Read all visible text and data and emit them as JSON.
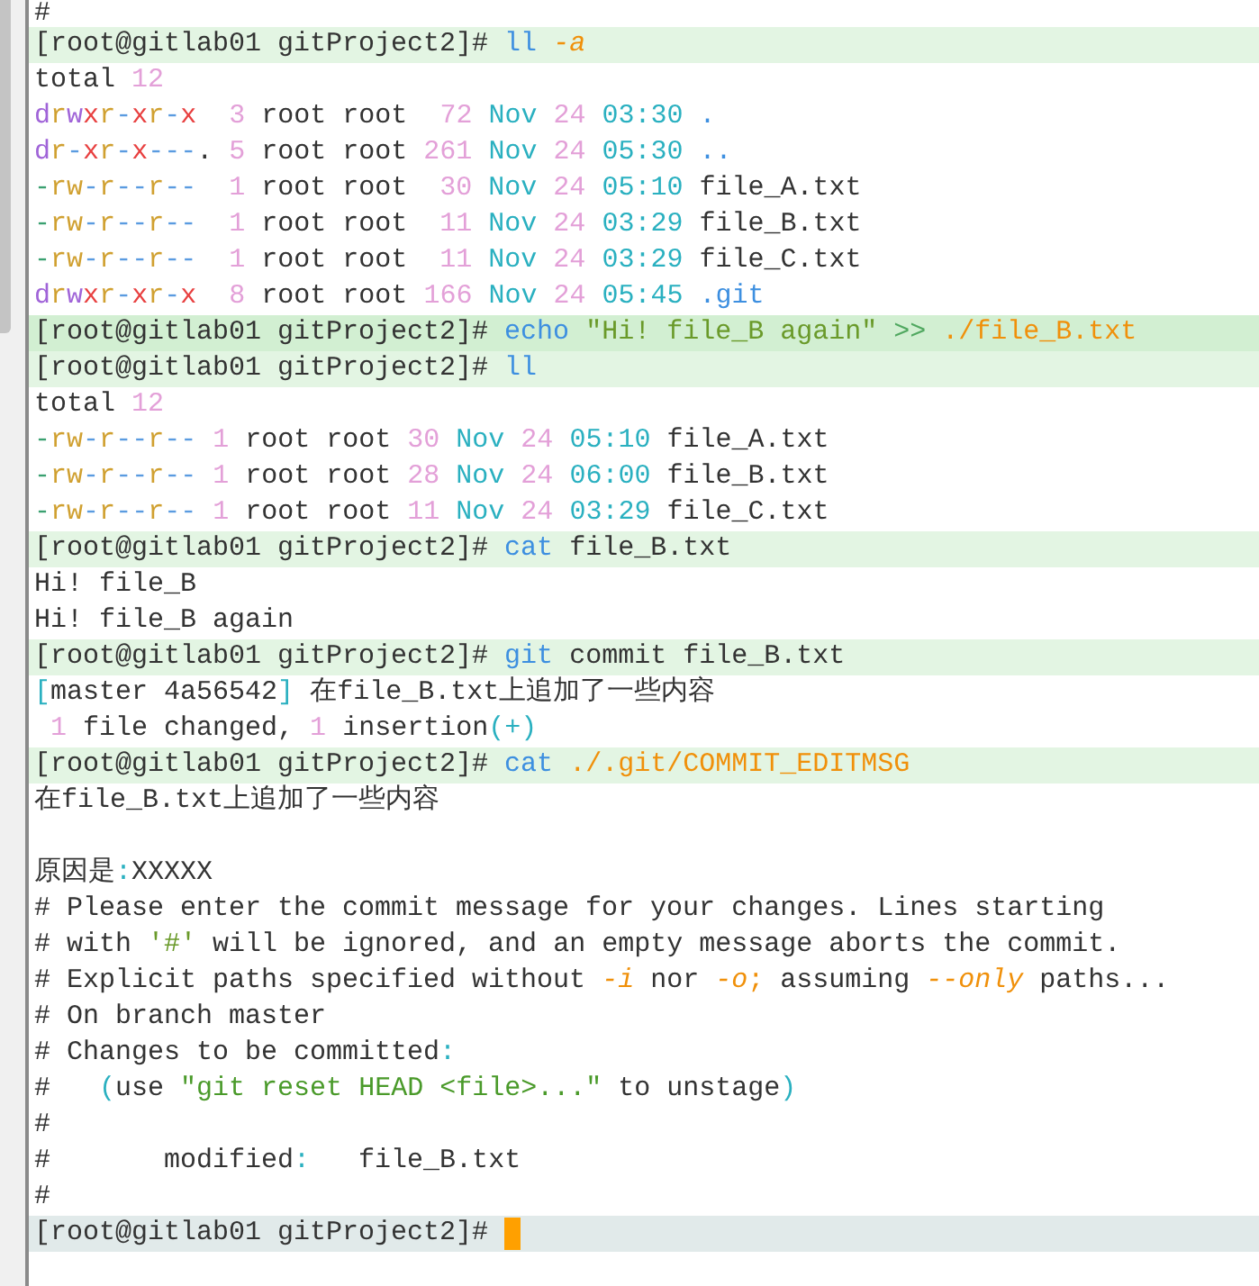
{
  "terminal": {
    "lines": [
      {
        "kind": "output",
        "segments": [
          {
            "text": "#",
            "color": "#333333"
          }
        ]
      },
      {
        "kind": "command",
        "segments": [
          {
            "text": "[root@gitlab01 gitProject2]# ",
            "color": "#333333"
          },
          {
            "text": "ll ",
            "color": "#3d8fe0"
          },
          {
            "text": "-a",
            "color": "#f0900a",
            "italic": true
          }
        ]
      },
      {
        "kind": "output",
        "segments": [
          {
            "text": "total ",
            "color": "#333333"
          },
          {
            "text": "12",
            "color": "#e3a0d8"
          }
        ]
      },
      {
        "kind": "output",
        "segments": [
          {
            "text": "d",
            "color": "#a064d8"
          },
          {
            "text": "r",
            "color": "#d0a030"
          },
          {
            "text": "w",
            "color": "#a064d8"
          },
          {
            "text": "x",
            "color": "#e84040"
          },
          {
            "text": "r",
            "color": "#d0a030"
          },
          {
            "text": "-",
            "color": "#5a9be0"
          },
          {
            "text": "x",
            "color": "#e84040"
          },
          {
            "text": "r",
            "color": "#d0a030"
          },
          {
            "text": "-",
            "color": "#5a9be0"
          },
          {
            "text": "x",
            "color": "#e84040"
          },
          {
            "text": "  3 ",
            "color": "#e3a0d8"
          },
          {
            "text": "root root ",
            "color": "#333333"
          },
          {
            "text": " 72 ",
            "color": "#e3a0d8"
          },
          {
            "text": "Nov ",
            "color": "#2ab0c0"
          },
          {
            "text": "24 ",
            "color": "#e3a0d8"
          },
          {
            "text": "03:30 ",
            "color": "#2ab0c0"
          },
          {
            "text": ".",
            "color": "#3d8fe0"
          }
        ]
      },
      {
        "kind": "output",
        "segments": [
          {
            "text": "d",
            "color": "#a064d8"
          },
          {
            "text": "r",
            "color": "#d0a030"
          },
          {
            "text": "-",
            "color": "#5a9be0"
          },
          {
            "text": "x",
            "color": "#e84040"
          },
          {
            "text": "r",
            "color": "#d0a030"
          },
          {
            "text": "-",
            "color": "#5a9be0"
          },
          {
            "text": "x",
            "color": "#e84040"
          },
          {
            "text": "---",
            "color": "#5a9be0"
          },
          {
            "text": ". ",
            "color": "#333333"
          },
          {
            "text": "5 ",
            "color": "#e3a0d8"
          },
          {
            "text": "root root ",
            "color": "#333333"
          },
          {
            "text": "261 ",
            "color": "#e3a0d8"
          },
          {
            "text": "Nov ",
            "color": "#2ab0c0"
          },
          {
            "text": "24 ",
            "color": "#e3a0d8"
          },
          {
            "text": "05:30 ",
            "color": "#2ab0c0"
          },
          {
            "text": "..",
            "color": "#3d8fe0"
          }
        ]
      },
      {
        "kind": "output",
        "segments": [
          {
            "text": "-",
            "color": "#3aa070"
          },
          {
            "text": "rw",
            "color": "#d0a030"
          },
          {
            "text": "-",
            "color": "#5a9be0"
          },
          {
            "text": "r",
            "color": "#d0a030"
          },
          {
            "text": "--",
            "color": "#5a9be0"
          },
          {
            "text": "r",
            "color": "#d0a030"
          },
          {
            "text": "--",
            "color": "#5a9be0"
          },
          {
            "text": "  1 ",
            "color": "#e3a0d8"
          },
          {
            "text": "root root ",
            "color": "#333333"
          },
          {
            "text": " 30 ",
            "color": "#e3a0d8"
          },
          {
            "text": "Nov ",
            "color": "#2ab0c0"
          },
          {
            "text": "24 ",
            "color": "#e3a0d8"
          },
          {
            "text": "05:10 ",
            "color": "#2ab0c0"
          },
          {
            "text": "file_A.txt",
            "color": "#333333"
          }
        ]
      },
      {
        "kind": "output",
        "segments": [
          {
            "text": "-",
            "color": "#3aa070"
          },
          {
            "text": "rw",
            "color": "#d0a030"
          },
          {
            "text": "-",
            "color": "#5a9be0"
          },
          {
            "text": "r",
            "color": "#d0a030"
          },
          {
            "text": "--",
            "color": "#5a9be0"
          },
          {
            "text": "r",
            "color": "#d0a030"
          },
          {
            "text": "--",
            "color": "#5a9be0"
          },
          {
            "text": "  1 ",
            "color": "#e3a0d8"
          },
          {
            "text": "root root ",
            "color": "#333333"
          },
          {
            "text": " 11 ",
            "color": "#e3a0d8"
          },
          {
            "text": "Nov ",
            "color": "#2ab0c0"
          },
          {
            "text": "24 ",
            "color": "#e3a0d8"
          },
          {
            "text": "03:29 ",
            "color": "#2ab0c0"
          },
          {
            "text": "file_B.txt",
            "color": "#333333"
          }
        ]
      },
      {
        "kind": "output",
        "segments": [
          {
            "text": "-",
            "color": "#3aa070"
          },
          {
            "text": "rw",
            "color": "#d0a030"
          },
          {
            "text": "-",
            "color": "#5a9be0"
          },
          {
            "text": "r",
            "color": "#d0a030"
          },
          {
            "text": "--",
            "color": "#5a9be0"
          },
          {
            "text": "r",
            "color": "#d0a030"
          },
          {
            "text": "--",
            "color": "#5a9be0"
          },
          {
            "text": "  1 ",
            "color": "#e3a0d8"
          },
          {
            "text": "root root ",
            "color": "#333333"
          },
          {
            "text": " 11 ",
            "color": "#e3a0d8"
          },
          {
            "text": "Nov ",
            "color": "#2ab0c0"
          },
          {
            "text": "24 ",
            "color": "#e3a0d8"
          },
          {
            "text": "03:29 ",
            "color": "#2ab0c0"
          },
          {
            "text": "file_C.txt",
            "color": "#333333"
          }
        ]
      },
      {
        "kind": "output",
        "segments": [
          {
            "text": "d",
            "color": "#a064d8"
          },
          {
            "text": "r",
            "color": "#d0a030"
          },
          {
            "text": "w",
            "color": "#a064d8"
          },
          {
            "text": "x",
            "color": "#e84040"
          },
          {
            "text": "r",
            "color": "#d0a030"
          },
          {
            "text": "-",
            "color": "#5a9be0"
          },
          {
            "text": "x",
            "color": "#e84040"
          },
          {
            "text": "r",
            "color": "#d0a030"
          },
          {
            "text": "-",
            "color": "#5a9be0"
          },
          {
            "text": "x",
            "color": "#e84040"
          },
          {
            "text": "  8 ",
            "color": "#e3a0d8"
          },
          {
            "text": "root root ",
            "color": "#333333"
          },
          {
            "text": "166 ",
            "color": "#e3a0d8"
          },
          {
            "text": "Nov ",
            "color": "#2ab0c0"
          },
          {
            "text": "24 ",
            "color": "#e3a0d8"
          },
          {
            "text": "05:45 ",
            "color": "#2ab0c0"
          },
          {
            "text": ".git",
            "color": "#3d8fe0"
          }
        ]
      },
      {
        "kind": "command_active",
        "segments": [
          {
            "text": "[root@gitlab01 gitProject2]# ",
            "color": "#333333"
          },
          {
            "text": "echo",
            "color": "#3d8fe0"
          },
          {
            "text": " \"Hi! file_B again\" ",
            "color": "#6a9a2a"
          },
          {
            "text": ">> ",
            "color": "#50a860"
          },
          {
            "text": "./file_B.txt",
            "color": "#f0900a"
          }
        ]
      },
      {
        "kind": "command",
        "segments": [
          {
            "text": "[root@gitlab01 gitProject2]# ",
            "color": "#333333"
          },
          {
            "text": "ll",
            "color": "#3d8fe0"
          }
        ]
      },
      {
        "kind": "output",
        "segments": [
          {
            "text": "total ",
            "color": "#333333"
          },
          {
            "text": "12",
            "color": "#e3a0d8"
          }
        ]
      },
      {
        "kind": "output",
        "segments": [
          {
            "text": "-",
            "color": "#3aa070"
          },
          {
            "text": "rw",
            "color": "#d0a030"
          },
          {
            "text": "-",
            "color": "#5a9be0"
          },
          {
            "text": "r",
            "color": "#d0a030"
          },
          {
            "text": "--",
            "color": "#5a9be0"
          },
          {
            "text": "r",
            "color": "#d0a030"
          },
          {
            "text": "--",
            "color": "#5a9be0"
          },
          {
            "text": " 1 ",
            "color": "#e3a0d8"
          },
          {
            "text": "root root ",
            "color": "#333333"
          },
          {
            "text": "30 ",
            "color": "#e3a0d8"
          },
          {
            "text": "Nov ",
            "color": "#2ab0c0"
          },
          {
            "text": "24 ",
            "color": "#e3a0d8"
          },
          {
            "text": "05:10 ",
            "color": "#2ab0c0"
          },
          {
            "text": "file_A.txt",
            "color": "#333333"
          }
        ]
      },
      {
        "kind": "output",
        "segments": [
          {
            "text": "-",
            "color": "#3aa070"
          },
          {
            "text": "rw",
            "color": "#d0a030"
          },
          {
            "text": "-",
            "color": "#5a9be0"
          },
          {
            "text": "r",
            "color": "#d0a030"
          },
          {
            "text": "--",
            "color": "#5a9be0"
          },
          {
            "text": "r",
            "color": "#d0a030"
          },
          {
            "text": "--",
            "color": "#5a9be0"
          },
          {
            "text": " 1 ",
            "color": "#e3a0d8"
          },
          {
            "text": "root root ",
            "color": "#333333"
          },
          {
            "text": "28 ",
            "color": "#e3a0d8"
          },
          {
            "text": "Nov ",
            "color": "#2ab0c0"
          },
          {
            "text": "24 ",
            "color": "#e3a0d8"
          },
          {
            "text": "06:00 ",
            "color": "#2ab0c0"
          },
          {
            "text": "file_B.txt",
            "color": "#333333"
          }
        ]
      },
      {
        "kind": "output",
        "segments": [
          {
            "text": "-",
            "color": "#3aa070"
          },
          {
            "text": "rw",
            "color": "#d0a030"
          },
          {
            "text": "-",
            "color": "#5a9be0"
          },
          {
            "text": "r",
            "color": "#d0a030"
          },
          {
            "text": "--",
            "color": "#5a9be0"
          },
          {
            "text": "r",
            "color": "#d0a030"
          },
          {
            "text": "--",
            "color": "#5a9be0"
          },
          {
            "text": " 1 ",
            "color": "#e3a0d8"
          },
          {
            "text": "root root ",
            "color": "#333333"
          },
          {
            "text": "11 ",
            "color": "#e3a0d8"
          },
          {
            "text": "Nov ",
            "color": "#2ab0c0"
          },
          {
            "text": "24 ",
            "color": "#e3a0d8"
          },
          {
            "text": "03:29 ",
            "color": "#2ab0c0"
          },
          {
            "text": "file_C.txt",
            "color": "#333333"
          }
        ]
      },
      {
        "kind": "command",
        "segments": [
          {
            "text": "[root@gitlab01 gitProject2]# ",
            "color": "#333333"
          },
          {
            "text": "cat",
            "color": "#3d8fe0"
          },
          {
            "text": " file_B.txt",
            "color": "#333333"
          }
        ]
      },
      {
        "kind": "output",
        "segments": [
          {
            "text": "Hi! file_B",
            "color": "#333333"
          }
        ]
      },
      {
        "kind": "output",
        "segments": [
          {
            "text": "Hi! file_B again",
            "color": "#333333"
          }
        ]
      },
      {
        "kind": "command",
        "segments": [
          {
            "text": "[root@gitlab01 gitProject2]# ",
            "color": "#333333"
          },
          {
            "text": "git",
            "color": "#3d8fe0"
          },
          {
            "text": " commit file_B.txt",
            "color": "#333333"
          }
        ]
      },
      {
        "kind": "output",
        "segments": [
          {
            "text": "[",
            "color": "#2ab0c0"
          },
          {
            "text": "master 4a56542",
            "color": "#333333"
          },
          {
            "text": "]",
            "color": "#2ab0c0"
          },
          {
            "text": " 在file_B.txt上追加了一些内容",
            "color": "#333333"
          }
        ]
      },
      {
        "kind": "output",
        "segments": [
          {
            "text": " 1 ",
            "color": "#e3a0d8"
          },
          {
            "text": "file changed, ",
            "color": "#333333"
          },
          {
            "text": "1 ",
            "color": "#e3a0d8"
          },
          {
            "text": "insertion",
            "color": "#333333"
          },
          {
            "text": "(+)",
            "color": "#2ab0c0"
          }
        ]
      },
      {
        "kind": "command",
        "segments": [
          {
            "text": "[root@gitlab01 gitProject2]# ",
            "color": "#333333"
          },
          {
            "text": "cat",
            "color": "#3d8fe0"
          },
          {
            "text": " ./.git/COMMIT_EDITMSG",
            "color": "#f0900a"
          }
        ]
      },
      {
        "kind": "output",
        "segments": [
          {
            "text": "在file_B.txt上追加了一些内容",
            "color": "#333333"
          }
        ]
      },
      {
        "kind": "blank"
      },
      {
        "kind": "output",
        "segments": [
          {
            "text": "原因是",
            "color": "#333333"
          },
          {
            "text": ":",
            "color": "#2ab0c0"
          },
          {
            "text": "XXXXX",
            "color": "#333333"
          }
        ]
      },
      {
        "kind": "output",
        "segments": [
          {
            "text": "# Please enter the commit message for your changes. Lines starting",
            "color": "#333333"
          }
        ]
      },
      {
        "kind": "output",
        "segments": [
          {
            "text": "# with ",
            "color": "#333333"
          },
          {
            "text": "'#'",
            "color": "#6a9a2a"
          },
          {
            "text": " will be ignored, and an empty message aborts the commit.",
            "color": "#333333"
          }
        ]
      },
      {
        "kind": "output",
        "segments": [
          {
            "text": "# Explicit paths specified without ",
            "color": "#333333"
          },
          {
            "text": "-i",
            "color": "#f0900a",
            "italic": true
          },
          {
            "text": " nor ",
            "color": "#333333"
          },
          {
            "text": "-o",
            "color": "#f0900a",
            "italic": true
          },
          {
            "text": ";",
            "color": "#f0900a"
          },
          {
            "text": " assuming ",
            "color": "#333333"
          },
          {
            "text": "--only",
            "color": "#f0900a",
            "italic": true
          },
          {
            "text": " paths...",
            "color": "#333333"
          }
        ]
      },
      {
        "kind": "output",
        "segments": [
          {
            "text": "# On branch master",
            "color": "#333333"
          }
        ]
      },
      {
        "kind": "output",
        "segments": [
          {
            "text": "# Changes to be committed",
            "color": "#333333"
          },
          {
            "text": ":",
            "color": "#2ab0c0"
          }
        ]
      },
      {
        "kind": "output",
        "segments": [
          {
            "text": "#   ",
            "color": "#333333"
          },
          {
            "text": "(",
            "color": "#2ab0c0"
          },
          {
            "text": "use ",
            "color": "#333333"
          },
          {
            "text": "\"git reset HEAD <file>...\"",
            "color": "#4a9a2a"
          },
          {
            "text": " to unstage",
            "color": "#333333"
          },
          {
            "text": ")",
            "color": "#2ab0c0"
          }
        ]
      },
      {
        "kind": "output",
        "segments": [
          {
            "text": "#",
            "color": "#333333"
          }
        ]
      },
      {
        "kind": "output",
        "segments": [
          {
            "text": "#       modified",
            "color": "#333333"
          },
          {
            "text": ":",
            "color": "#2ab0c0"
          },
          {
            "text": "   file_B.txt",
            "color": "#333333"
          }
        ]
      },
      {
        "kind": "output",
        "segments": [
          {
            "text": "#",
            "color": "#333333"
          }
        ]
      },
      {
        "kind": "current",
        "segments": [
          {
            "text": "[root@gitlab01 gitProject2]# ",
            "color": "#333333"
          }
        ]
      }
    ]
  }
}
